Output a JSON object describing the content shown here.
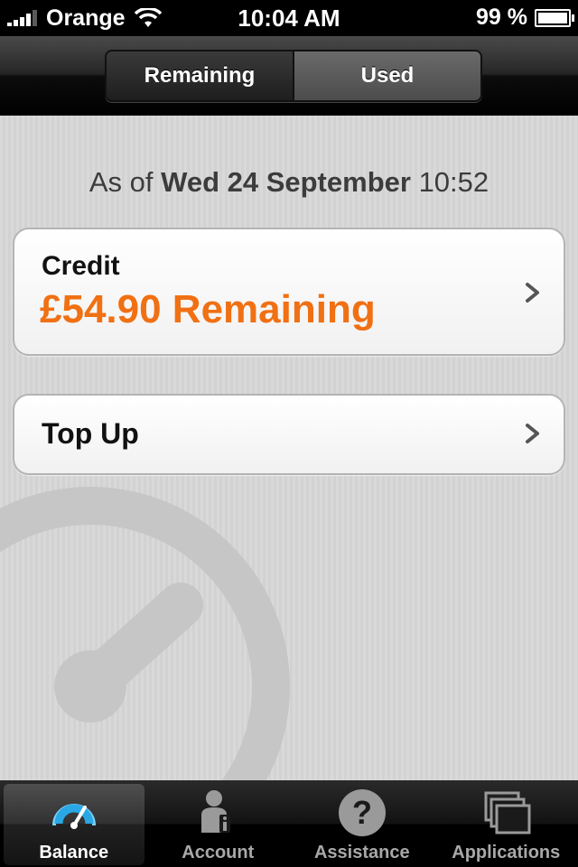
{
  "status_bar": {
    "carrier": "Orange",
    "time": "10:04 AM",
    "battery": "99 %",
    "battery_level": 0.99
  },
  "segmented": {
    "remaining_label": "Remaining",
    "used_label": "Used"
  },
  "as_of": {
    "prefix": "As of",
    "date": "Wed 24 September",
    "time": "10:52"
  },
  "credit": {
    "label": "Credit",
    "value": "£54.90 Remaining"
  },
  "top_up": {
    "label": "Top Up"
  },
  "tabs": [
    {
      "label": "Balance",
      "icon": "gauge-icon"
    },
    {
      "label": "Account",
      "icon": "person-info-icon"
    },
    {
      "label": "Assistance",
      "icon": "question-icon"
    },
    {
      "label": "Applications",
      "icon": "windows-stack-icon"
    }
  ],
  "colors": {
    "accent_orange": "#f07013",
    "selected_tab_icon": "#2aa8e6"
  }
}
